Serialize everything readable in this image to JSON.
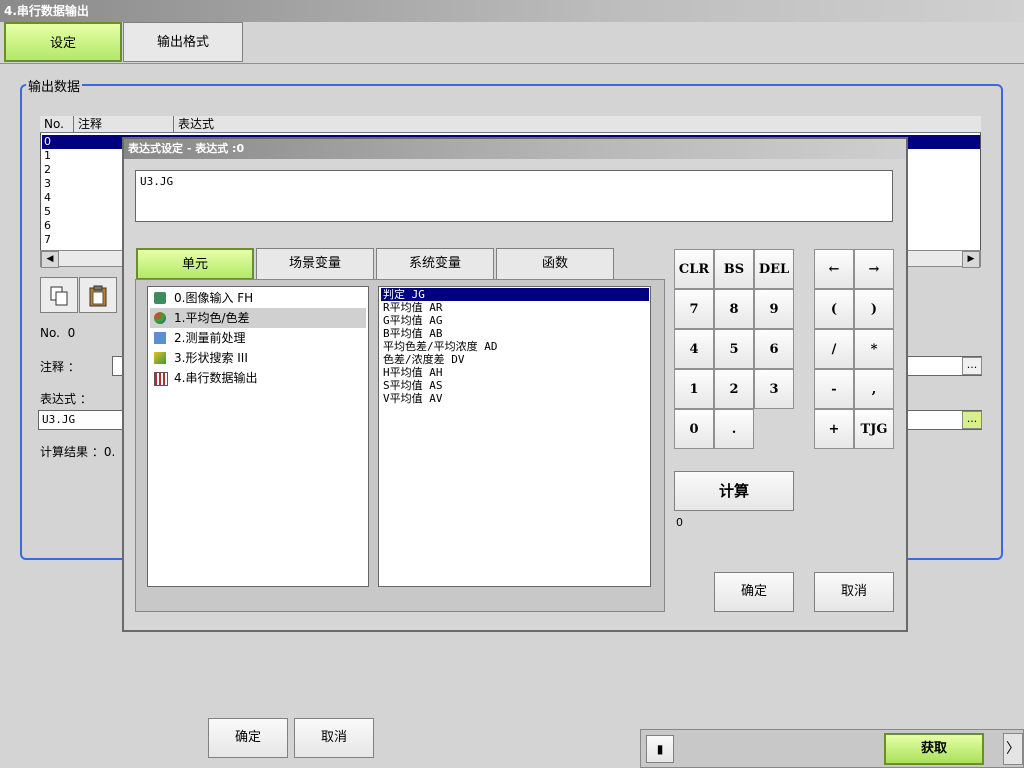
{
  "window": {
    "title": "4.串行数据输出"
  },
  "tabs": [
    {
      "label": "设定",
      "active": true
    },
    {
      "label": "输出格式",
      "active": false
    }
  ],
  "output_data": {
    "group_label": "输出数据",
    "columns": [
      "No.",
      "注释",
      "表达式"
    ],
    "rows": [
      "0",
      "1",
      "2",
      "3",
      "4",
      "5",
      "6",
      "7"
    ],
    "selected_row": 0,
    "no_label": "No.",
    "no_value": "0",
    "comment_label": "注释 ：",
    "comment_value": "",
    "expr_label": "表达式 ：",
    "expr_value": "U3.JG",
    "result_label": "计算结果 ：0."
  },
  "icons": {
    "copy": "copy-icon",
    "paste": "paste-icon",
    "stop": "stop-icon",
    "arrow_right": "chevron-right-icon"
  },
  "main_buttons": {
    "ok": "确定",
    "cancel": "取消"
  },
  "bottom": {
    "fetch": "获取",
    "stop_symbol": "▮",
    "more_symbol": "〉"
  },
  "dialog": {
    "title": "表达式设定 - 表达式 :0",
    "expression": "U3.JG",
    "tabs": [
      {
        "label": "单元",
        "active": true
      },
      {
        "label": "场景变量",
        "active": false
      },
      {
        "label": "系统变量",
        "active": false
      },
      {
        "label": "函数",
        "active": false
      }
    ],
    "units": [
      {
        "label": "0.图像输入 FH",
        "icon": "camera-icon"
      },
      {
        "label": "1.平均色/色差",
        "icon": "color-icon",
        "selected": true
      },
      {
        "label": "2.测量前处理",
        "icon": "filter-icon"
      },
      {
        "label": "3.形状搜索 III",
        "icon": "shape-search-icon"
      },
      {
        "label": "4.串行数据输出",
        "icon": "serial-output-icon"
      }
    ],
    "items": [
      {
        "label": "判定 JG",
        "selected": true
      },
      {
        "label": "R平均值 AR"
      },
      {
        "label": "G平均值 AG"
      },
      {
        "label": "B平均值 AB"
      },
      {
        "label": "平均色差/平均浓度 AD"
      },
      {
        "label": "色差/浓度差 DV"
      },
      {
        "label": "H平均值 AH"
      },
      {
        "label": "S平均值 AS"
      },
      {
        "label": "V平均值 AV"
      }
    ],
    "keypad": {
      "row1": [
        "CLR",
        "BS",
        "DEL"
      ],
      "row2": [
        "7",
        "8",
        "9"
      ],
      "row3": [
        "4",
        "5",
        "6"
      ],
      "row4": [
        "1",
        "2",
        "3"
      ],
      "row5": [
        "0",
        "."
      ],
      "ops_row1": [
        "←",
        "→"
      ],
      "ops_row2": [
        "(",
        ")"
      ],
      "ops_row3": [
        "/",
        "*"
      ],
      "ops_row4": [
        "-",
        ","
      ],
      "ops_row5": [
        "+",
        "TJG"
      ]
    },
    "calc_label": "计算",
    "calc_result": "0",
    "ok": "确定",
    "cancel": "取消"
  },
  "colors": {
    "accent_green": "#b3e86a",
    "selection": "#000080",
    "group_border": "#3a6ae0"
  }
}
